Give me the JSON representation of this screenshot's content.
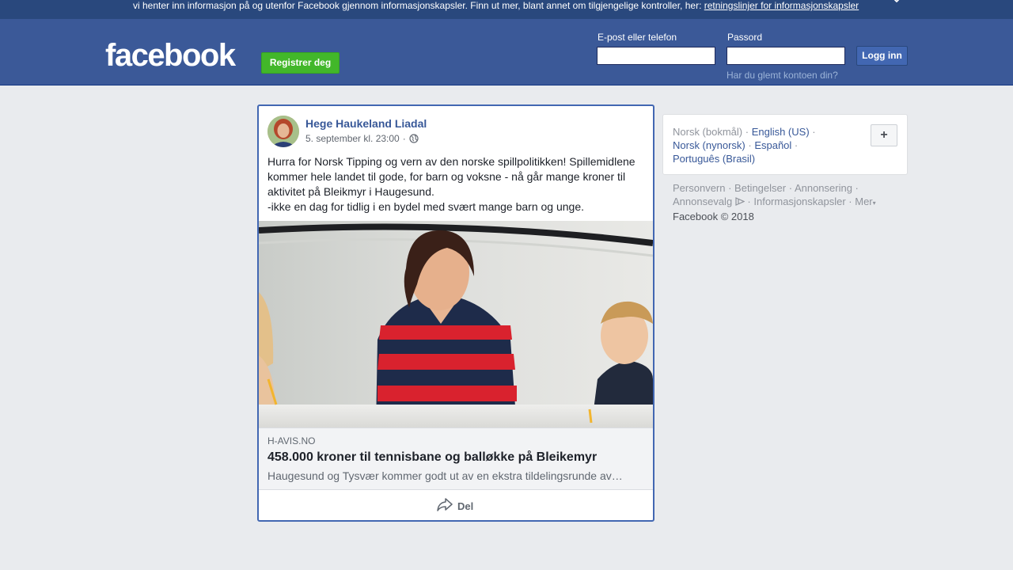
{
  "cookie_banner": {
    "text": "vi henter inn informasjon på og utenfor Facebook gjennom informasjonskapsler. Finn ut mer, blant annet om tilgjengelige kontroller, her: ",
    "link": "retningslinjer for informasjonskapsler",
    "close_icon": "close-icon"
  },
  "header": {
    "logo": "facebook",
    "register_label": "Registrer deg",
    "email_label": "E-post eller telefon",
    "email_value": "",
    "password_label": "Passord",
    "password_value": "",
    "login_label": "Logg inn",
    "forgot_label": "Har du glemt kontoen din?",
    "colors": {
      "bar": "#3b5998",
      "register": "#42b72a",
      "login": "#4267b2"
    }
  },
  "post": {
    "author": "Hege Haukeland Liadal",
    "timestamp": "5. september kl. 23:00",
    "separator": "·",
    "privacy_icon": "globe-icon",
    "text": [
      "Hurra for Norsk Tipping og vern av den norske spillpolitikken! Spillemidlene kommer hele landet til gode, for barn og voksne - nå går mange kroner til aktivitet på Bleikmyr i Haugesund.",
      "-ikke en dag for tidlig i en bydel med svært mange barn og unge."
    ],
    "link": {
      "domain": "H-AVIS.NO",
      "title": "458.000 kroner til tennisbane og balløkke på Bleikemyr",
      "description": "Haugesund og Tysvær kommer godt ut av en ekstra tildelingsrunde av…"
    },
    "share_label": "Del",
    "share_icon": "share-icon"
  },
  "sidebar": {
    "languages": {
      "current": "Norsk (bokmål)",
      "others": [
        "English (US)",
        "Norsk (nynorsk)",
        "Español",
        "Português (Brasil)"
      ]
    },
    "add_language_label": "+",
    "footer": {
      "links": [
        "Personvern",
        "Betingelser",
        "Annonsering",
        "Annonsevalg",
        "Informasjonskapsler",
        "Mer"
      ],
      "copyright": "Facebook © 2018"
    }
  }
}
